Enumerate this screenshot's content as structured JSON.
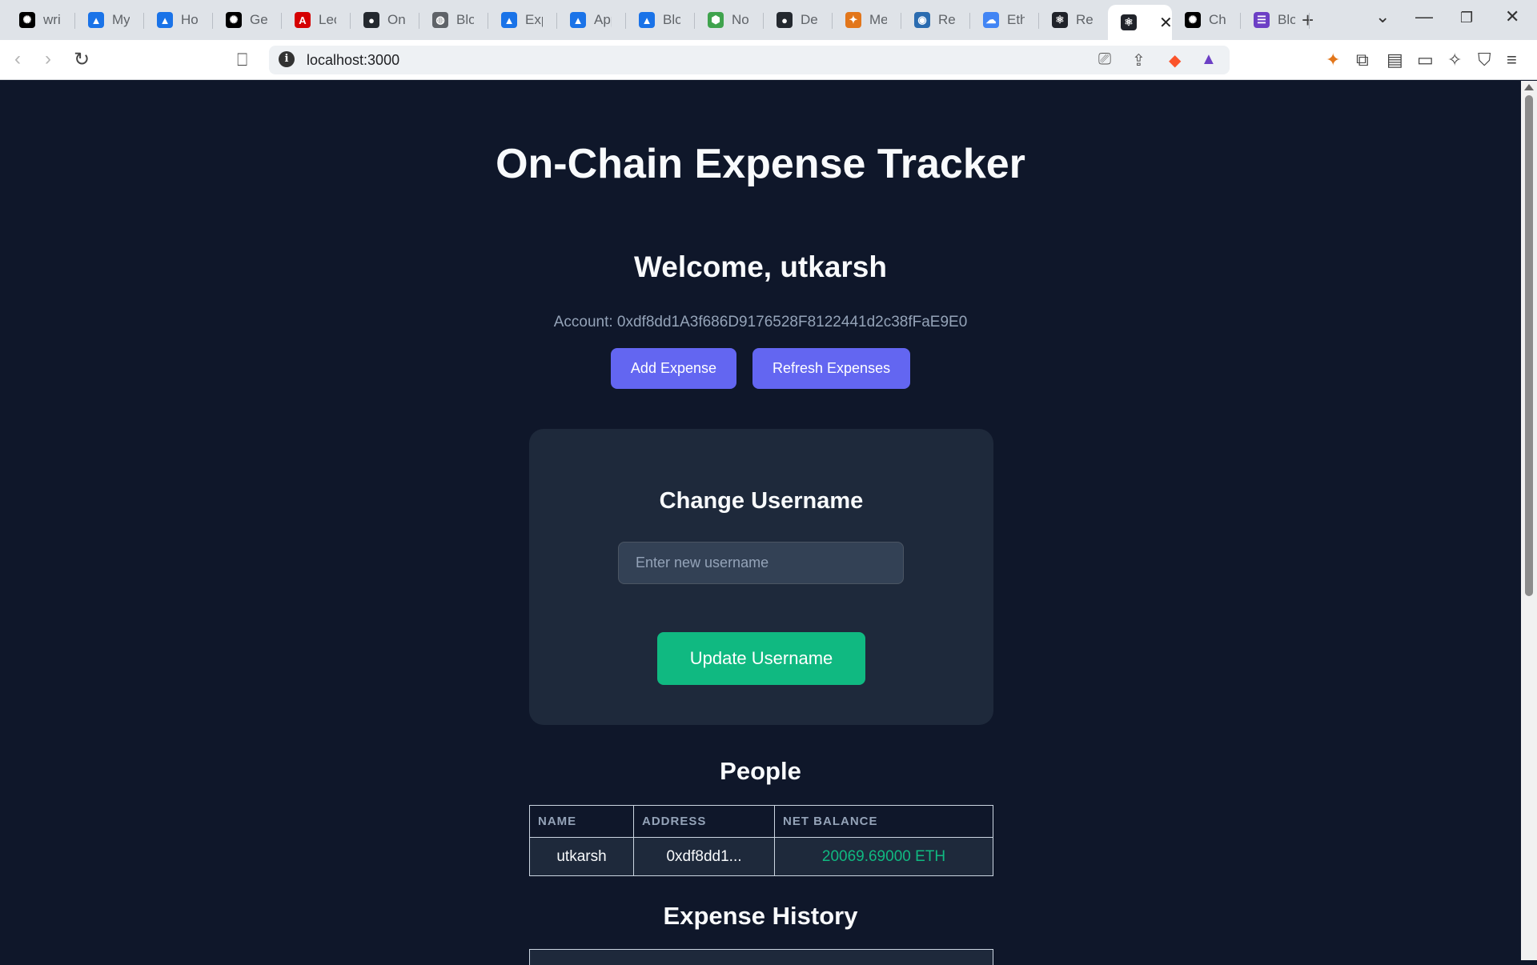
{
  "browser": {
    "tabs": [
      {
        "title": "writ",
        "icon": "openai-icon",
        "color": "#000000"
      },
      {
        "title": "My",
        "icon": "google-drive-icon",
        "color": "#1a73e8"
      },
      {
        "title": "Hor",
        "icon": "google-drive-icon",
        "color": "#1a73e8"
      },
      {
        "title": "Ger",
        "icon": "openai-icon",
        "color": "#000000"
      },
      {
        "title": "Lect",
        "icon": "pdf-icon",
        "color": "#d50000"
      },
      {
        "title": "On-",
        "icon": "github-icon",
        "color": "#24292f"
      },
      {
        "title": "Blo",
        "icon": "globe-icon",
        "color": "#5f6368"
      },
      {
        "title": "Exp",
        "icon": "google-drive-icon",
        "color": "#1a73e8"
      },
      {
        "title": "App",
        "icon": "google-drive-icon",
        "color": "#1a73e8"
      },
      {
        "title": "Blo",
        "icon": "google-drive-icon",
        "color": "#1a73e8"
      },
      {
        "title": "Noc",
        "icon": "cube-icon",
        "color": "#3fa34d"
      },
      {
        "title": "Del",
        "icon": "github-icon",
        "color": "#24292f"
      },
      {
        "title": "Met",
        "icon": "metamask-icon",
        "color": "#e2761b"
      },
      {
        "title": "Ren",
        "icon": "remix-icon",
        "color": "#2b6cb0"
      },
      {
        "title": "Eth",
        "icon": "cloud-icon",
        "color": "#4285f4"
      },
      {
        "title": "Rea",
        "icon": "react-icon",
        "color": "#20232a"
      },
      {
        "title": "",
        "icon": "react-icon",
        "color": "#20232a",
        "active": true
      },
      {
        "title": "Che",
        "icon": "openai-icon",
        "color": "#000000"
      },
      {
        "title": "Blo",
        "icon": "list-icon",
        "color": "#6c3fc5"
      }
    ],
    "url": "localhost:3000"
  },
  "app": {
    "title": "On-Chain Expense Tracker",
    "welcome": "Welcome, utkarsh",
    "account": "Account: 0xdf8dd1A3f686D9176528F8122441d2c38fFaE9E0",
    "add_expense_label": "Add Expense",
    "refresh_label": "Refresh Expenses",
    "change_username": {
      "heading": "Change Username",
      "placeholder": "Enter new username",
      "button_label": "Update Username"
    },
    "people": {
      "heading": "People",
      "columns": [
        "NAME",
        "ADDRESS",
        "NET BALANCE"
      ],
      "rows": [
        {
          "name": "utkarsh",
          "address": "0xdf8dd1...",
          "balance": "20069.69000 ETH"
        }
      ]
    },
    "history": {
      "heading": "Expense History"
    }
  },
  "colors": {
    "background": "#0f172a",
    "card": "#1e293b",
    "primary": "#6366f1",
    "success": "#10b981"
  }
}
